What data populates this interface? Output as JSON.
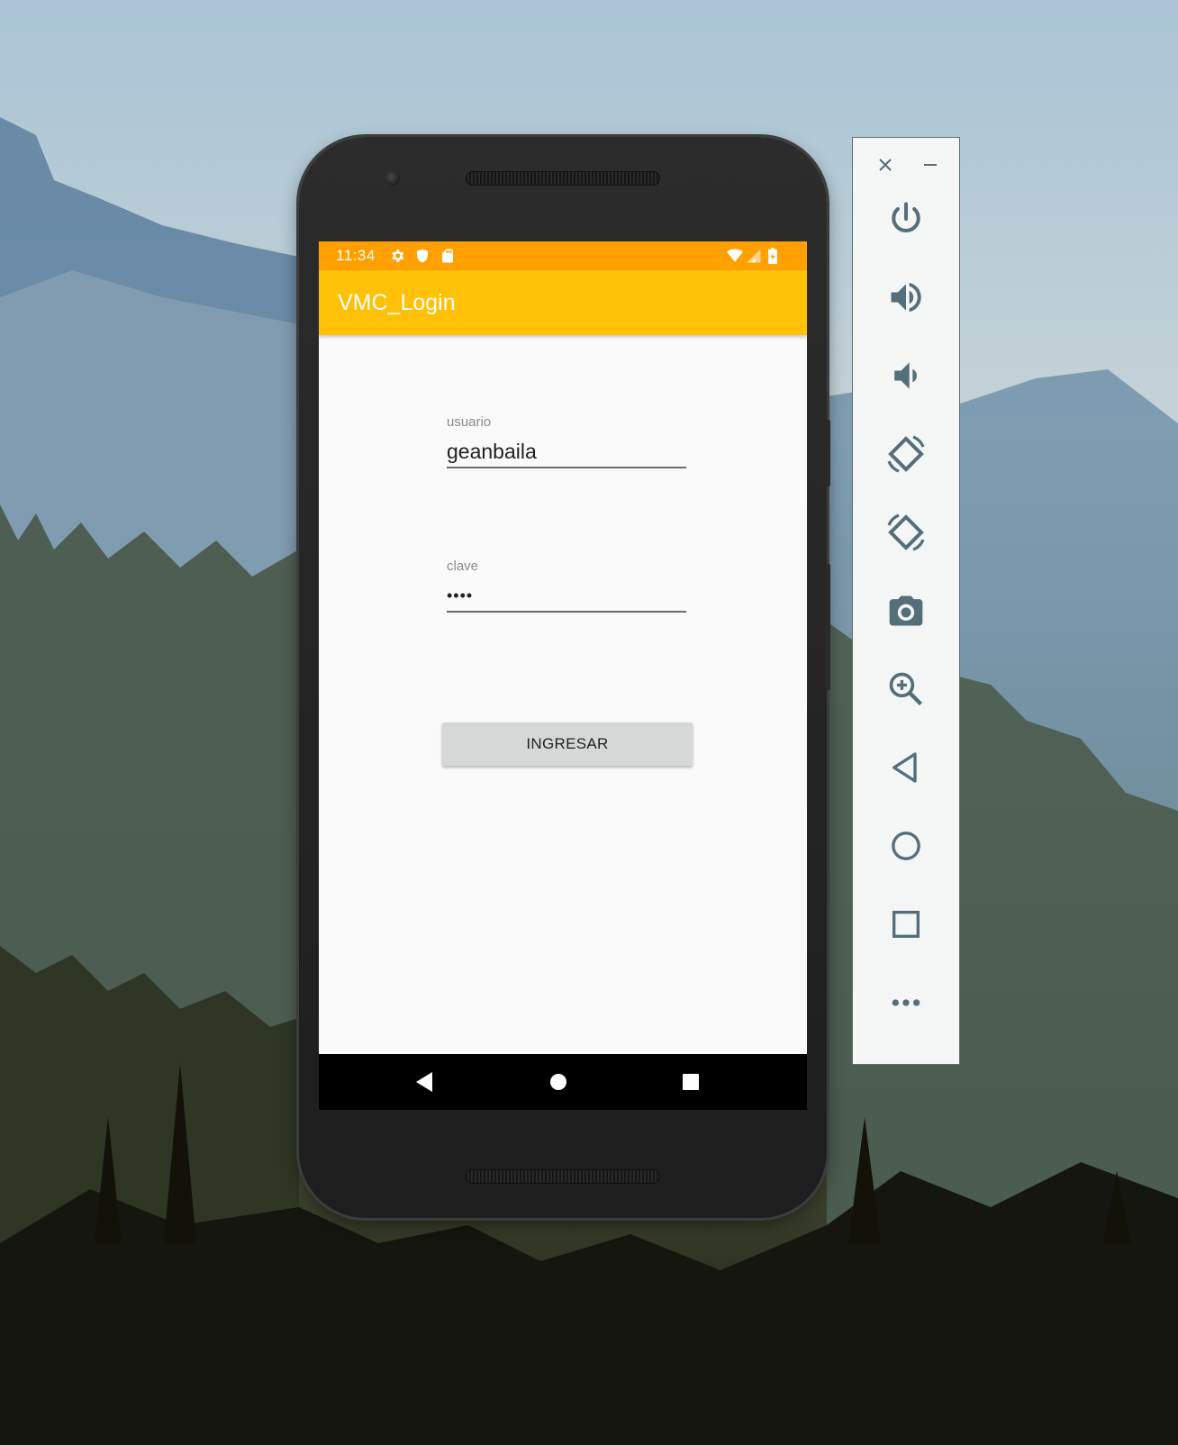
{
  "device": {
    "status_bar": {
      "time": "11:34",
      "left_icons": [
        "settings-icon",
        "shield-icon",
        "sd-card-icon"
      ],
      "right_icons": [
        "wifi-icon",
        "signal-icon",
        "battery-icon"
      ],
      "color": "#ffa000"
    },
    "app_bar": {
      "title": "VMC_Login",
      "color": "#ffc107"
    },
    "form": {
      "username": {
        "label": "usuario",
        "value": "geanbaila"
      },
      "password": {
        "label": "clave",
        "value": "••••"
      },
      "submit_label": "INGRESAR"
    },
    "nav_bar": {
      "buttons": [
        "back-icon",
        "home-icon",
        "recents-icon"
      ]
    }
  },
  "emulator_toolbar": {
    "window_controls": [
      "close-icon",
      "minimize-icon"
    ],
    "controls": [
      {
        "name": "power",
        "icon": "power-icon"
      },
      {
        "name": "volume-up",
        "icon": "volume-up-icon"
      },
      {
        "name": "volume-down",
        "icon": "volume-down-icon"
      },
      {
        "name": "rotate-left",
        "icon": "rotate-left-icon"
      },
      {
        "name": "rotate-right",
        "icon": "rotate-right-icon"
      },
      {
        "name": "screenshot",
        "icon": "camera-icon"
      },
      {
        "name": "zoom",
        "icon": "zoom-in-icon"
      },
      {
        "name": "back",
        "icon": "back-icon"
      },
      {
        "name": "home",
        "icon": "home-icon"
      },
      {
        "name": "overview",
        "icon": "overview-icon"
      },
      {
        "name": "more",
        "icon": "more-icon"
      }
    ],
    "icon_color": "#546e7a"
  }
}
